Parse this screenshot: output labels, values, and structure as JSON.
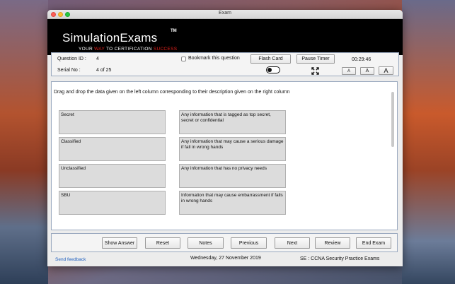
{
  "window": {
    "title": "Exam"
  },
  "banner": {
    "logo": "SimulationExams",
    "trademark": "TM",
    "tagline_parts": [
      "YOUR ",
      "WAY",
      " TO CERTIFICATION ",
      "SUCCESS"
    ]
  },
  "info": {
    "question_id_label": "Question ID :",
    "question_id_value": "4",
    "serial_label": "Serial No :",
    "serial_value": "4 of 25",
    "bookmark_label": "Bookmark this question",
    "bookmark_checked": false,
    "flash_card_label": "Flash Card",
    "pause_timer_label": "Pause Timer",
    "timer": "00:29:46",
    "font_small": "A",
    "font_medium": "A",
    "font_large": "A"
  },
  "question": {
    "instruction": "Drag and drop the data given on the left column corresponding to their description given on the right column",
    "terms": [
      "Secret",
      "Classified",
      "Unclassified",
      "SBU"
    ],
    "descriptions": [
      "Any information that is tagged as top secret, secret or confidential",
      "Any information that may cause a serious damage if fall in wrong hands",
      "Any information that has no privacy needs",
      "Information that may cause embarrassment if falls in wrong hands"
    ]
  },
  "nav": {
    "show_answer": "Show Answer",
    "reset": "Reset",
    "notes": "Notes",
    "previous": "Previous",
    "next": "Next",
    "review": "Review",
    "end_exam": "End Exam"
  },
  "footer": {
    "feedback": "Send feedback",
    "date": "Wednesday, 27 November 2019",
    "exam": "SE : CCNA Security Practice Exams"
  },
  "colors": {
    "banner_bg": "#000000",
    "accent_red": "#e2201b",
    "link_blue": "#1f5fbf",
    "panel_border": "#9aa9bf"
  }
}
